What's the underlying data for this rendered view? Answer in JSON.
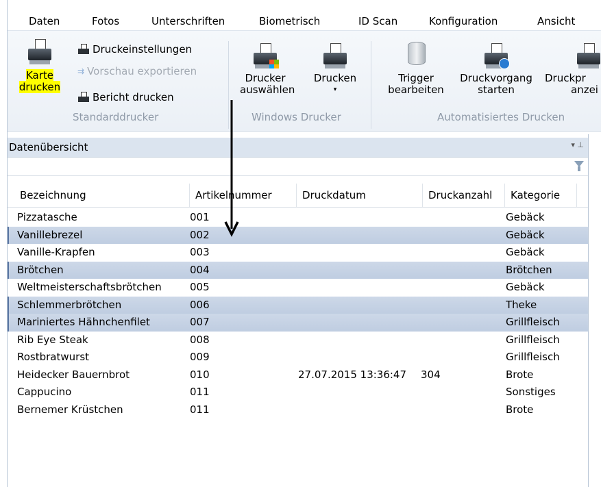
{
  "menu": {
    "items": [
      "Daten",
      "Fotos",
      "Unterschriften",
      "Biometrisch",
      "ID Scan",
      "Konfiguration",
      "Ansicht"
    ]
  },
  "ribbon": {
    "standard": {
      "print_card_line1": "Karte",
      "print_card_line2": "drucken",
      "print_settings": "Druckeinstellungen",
      "export_preview": "Vorschau exportieren",
      "print_report": "Bericht drucken",
      "group_label": "Standarddrucker"
    },
    "windows": {
      "select_printer_line1": "Drucker",
      "select_printer_line2": "auswählen",
      "print_line1": "Drucken",
      "print_caret": "▾",
      "group_label": "Windows Drucker"
    },
    "auto": {
      "edit_trigger_line1": "Trigger",
      "edit_trigger_line2": "bearbeiten",
      "start_job_line1": "Druckvorgang",
      "start_job_line2": "starten",
      "show_job_line1": "Druckpr",
      "show_job_line2": "anzei",
      "group_label": "Automatisiertes Drucken"
    }
  },
  "panel": {
    "title": "Datenübersicht",
    "controls": "▾ ⊥",
    "filter_value": ""
  },
  "grid": {
    "columns": [
      "Bezeichnung",
      "Artikelnummer",
      "Druckdatum",
      "Druckanzahl",
      "Kategorie"
    ],
    "rows": [
      [
        "Pizzatasche",
        "001",
        "",
        "",
        "Gebäck"
      ],
      [
        "Vanillebrezel",
        "002",
        "",
        "",
        "Gebäck"
      ],
      [
        "Vanille-Krapfen",
        "003",
        "",
        "",
        "Gebäck"
      ],
      [
        "Brötchen",
        "004",
        "",
        "",
        "Brötchen"
      ],
      [
        "Weltmeisterschaftsbrötchen",
        "005",
        "",
        "",
        "Gebäck"
      ],
      [
        "Schlemmerbrötchen",
        "006",
        "",
        "",
        "Theke"
      ],
      [
        "Mariniertes Hähnchenfilet",
        "007",
        "",
        "",
        "Grillfleisch"
      ],
      [
        "Rib Eye Steak",
        "008",
        "",
        "",
        "Grillfleisch"
      ],
      [
        "Rostbratwurst",
        "009",
        "",
        "",
        "Grillfleisch"
      ],
      [
        "Heidecker Bauernbrot",
        "010",
        "27.07.2015 13:36:47",
        "304",
        "Brote"
      ],
      [
        "Cappucino",
        "011",
        "",
        "",
        "Sonstiges"
      ],
      [
        "Bernemer Krüstchen",
        "011",
        "",
        "",
        "Brote"
      ]
    ],
    "selected_rows": [
      1,
      3,
      5,
      6
    ]
  },
  "colors": {
    "highlight": "#ffff00",
    "selected_row": "#c5d2e4",
    "panel_header": "#dbe4ef"
  }
}
